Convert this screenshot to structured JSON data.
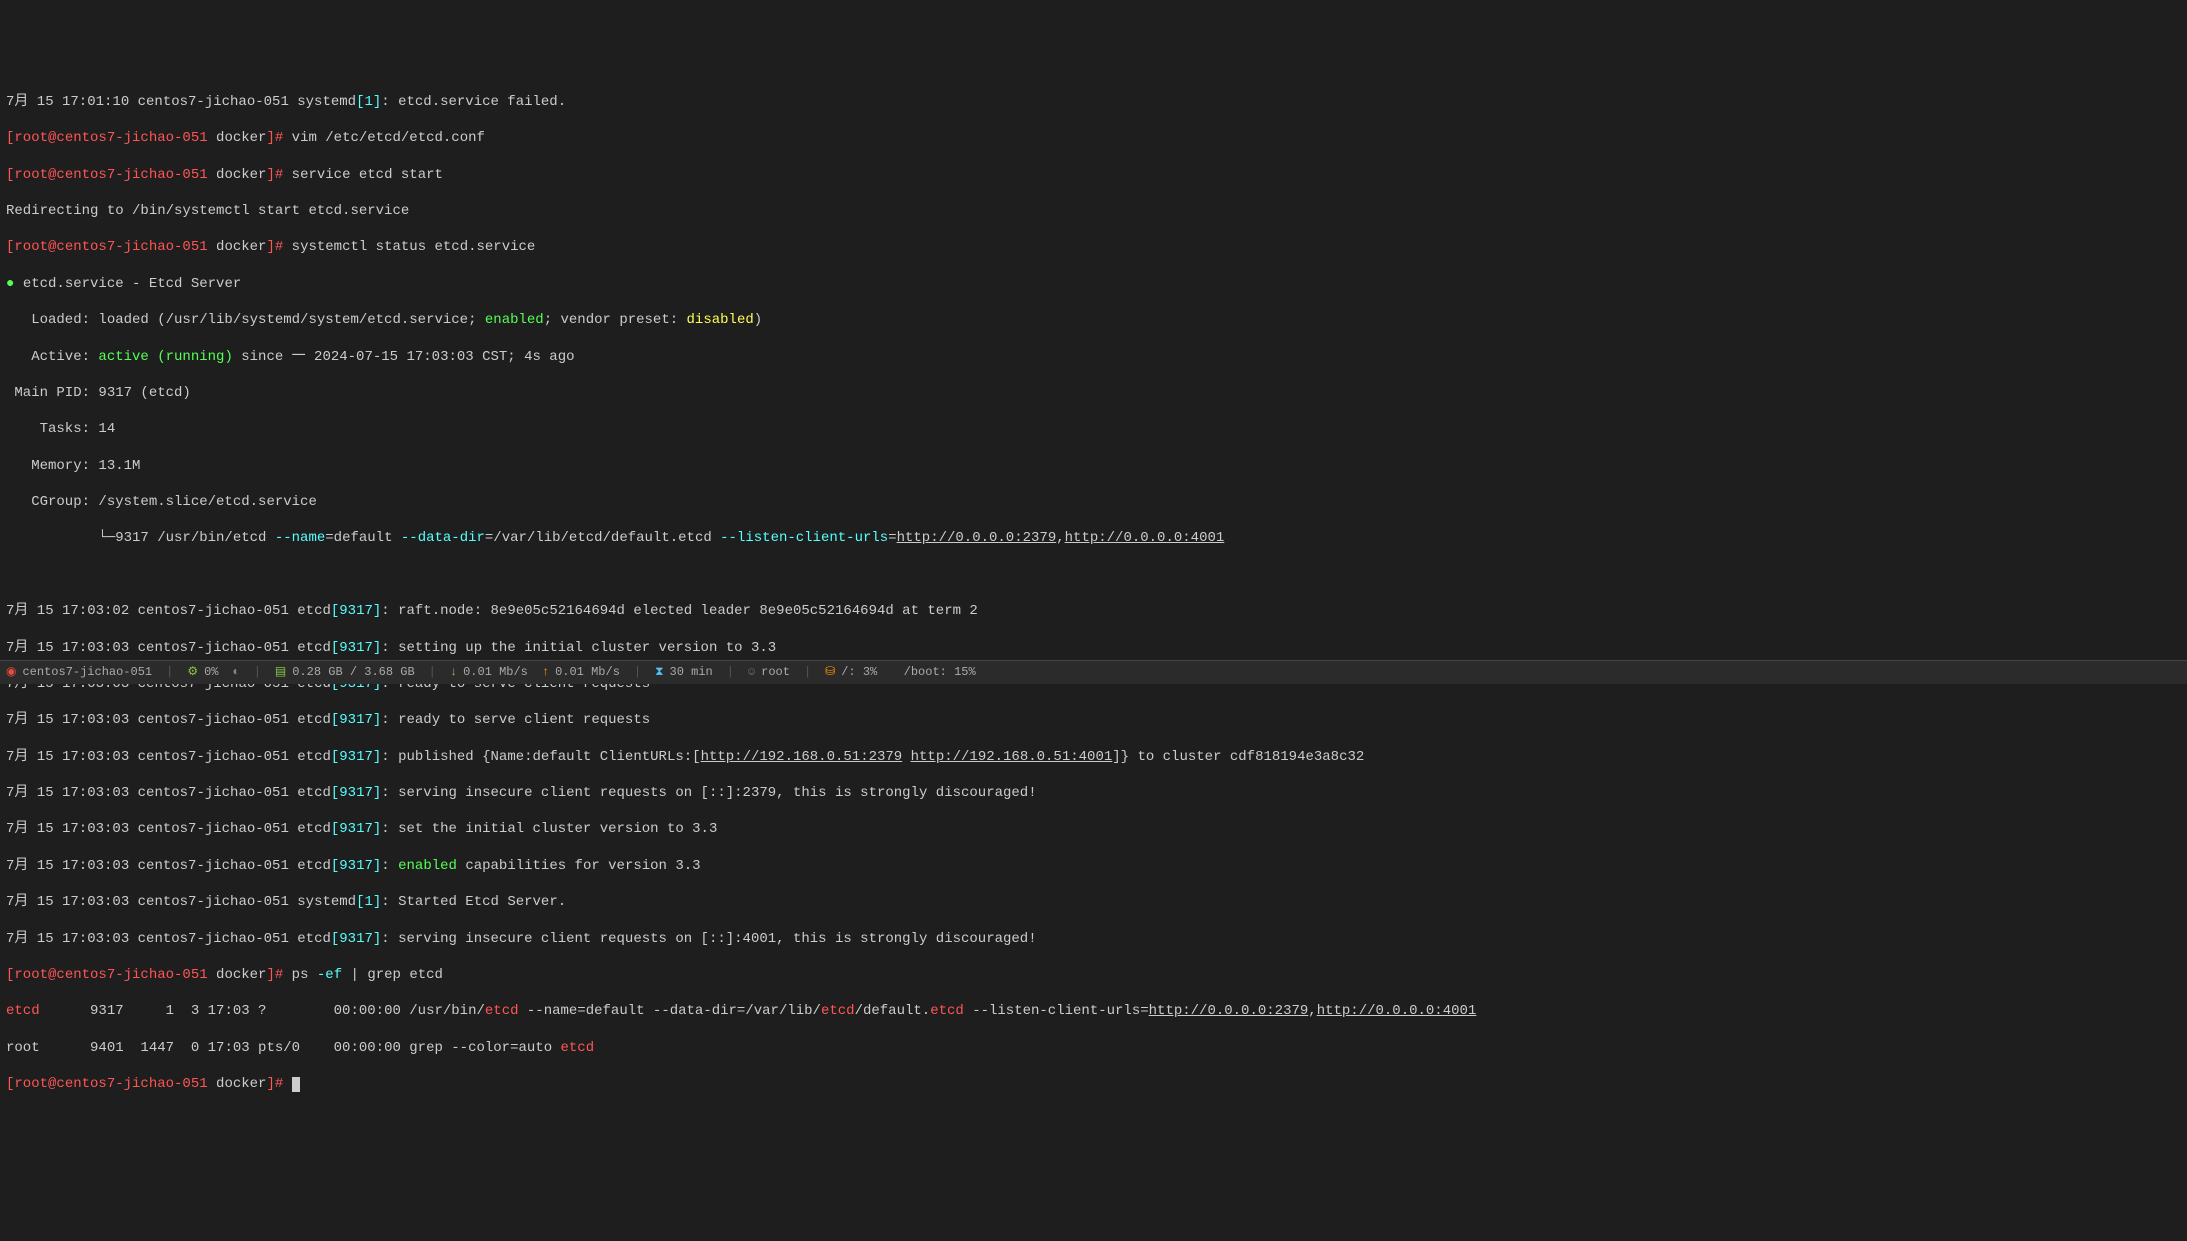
{
  "lines": {
    "l0_prefix": "7月 15 17:01:10 centos7-jichao-051 systemd",
    "l0_pid": "[1]",
    "l0_msg": ": etcd.service failed.",
    "prompt_open": "[",
    "prompt_user": "root@centos7-jichao-051",
    "prompt_path": " docker",
    "prompt_close": "]# ",
    "cmd1": "vim /etc/etcd/etcd.conf",
    "cmd2": "service etcd start",
    "redirect": "Redirecting to /bin/systemctl start etcd.service",
    "cmd3": "systemctl status etcd.service",
    "svc_name": "etcd.service - Etcd Server",
    "loaded_label": "   Loaded: loaded (/usr/lib/systemd/system/etcd.service; ",
    "loaded_enabled": "enabled",
    "loaded_vendor": "; vendor preset: ",
    "loaded_disabled": "disabled",
    "loaded_close": ")",
    "active_label": "   Active: ",
    "active_state": "active (running)",
    "active_since": " since 一 2024-07-15 17:03:03 CST; 4s ago",
    "mainpid": " Main PID: 9317 (etcd)",
    "tasks": "    Tasks: 14",
    "memory": "   Memory: 13.1M",
    "cgroup": "   CGroup: /system.slice/etcd.service",
    "tree_branch": "           └─9317 /usr/bin/etcd ",
    "opt_name": "--name",
    "opt_name_val": "=default ",
    "opt_datadir": "--data-dir",
    "opt_datadir_val": "=/var/lib/etcd/default.etcd ",
    "opt_listen": "--listen-client-urls",
    "url1": "http://0.0.0.0:2379",
    "url2": "http://0.0.0.0:4001",
    "log_prefix": "7月 15 17:03:0",
    "host": " centos7-jichao-051 etcd",
    "pid9317": "[9317]",
    "log1_t": "2",
    "log1": ": raft.node: 8e9e05c52164694d elected leader 8e9e05c52164694d at term 2",
    "log2_t": "3",
    "log2": ": setting up the initial cluster version to 3.3",
    "log3": ": ready to serve client requests",
    "log4": ": ready to serve client requests",
    "log5_pre": ": published {Name:default ClientURLs:[",
    "log5_url1": "http://192.168.0.51:2379",
    "log5_url2": "http://192.168.0.51:4001",
    "log5_post": "]} to cluster cdf818194e3a8c32",
    "log6": ": serving insecure client requests on [::]:2379, this is strongly discouraged!",
    "log7": ": set the initial cluster version to 3.3",
    "log8_pre": ": ",
    "log8_enabled": "enabled",
    "log8_post": " capabilities for version 3.3",
    "log9_host": " centos7-jichao-051 systemd",
    "log9_pid": "[1]",
    "log9": ": Started Etcd Server.",
    "log10": ": serving insecure client requests on [::]:4001, this is strongly discouraged!",
    "cmd4_pre": "ps ",
    "cmd4_opt": "-ef",
    "cmd4_pipe": " | grep etcd",
    "ps1_user": "etcd",
    "ps1_cols": "      9317     1  3 17:03 ?        00:00:00 /usr/bin/",
    "ps1_etcd": "etcd",
    "ps1_mid1": " --name=default --data-dir=/var/lib/",
    "ps1_mid2": "/default.",
    "ps1_mid3": " --listen-client-urls=",
    "ps2_user": "root",
    "ps2_cols": "      9401  1447  0 17:03 pts/0    00:00:00 grep --color=auto ",
    "ps2_etcd": "etcd"
  },
  "status": {
    "host": "centos7-jichao-051",
    "cpu": "0%",
    "mem": "0.28 GB / 3.68 GB",
    "netdown": "0.01 Mb/s",
    "netup": "0.01 Mb/s",
    "uptime": "30 min",
    "user": "root",
    "disk1": "/: 3%",
    "disk2": "/boot: 15%"
  }
}
